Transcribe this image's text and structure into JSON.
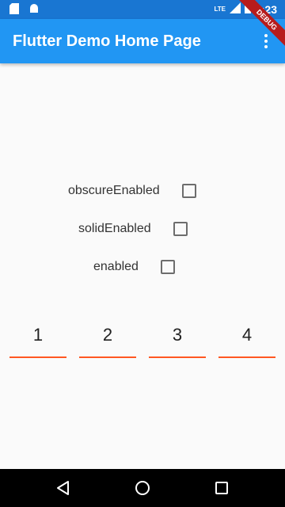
{
  "status_bar": {
    "network_label": "LTE",
    "time": "6:23"
  },
  "app_bar": {
    "title": "Flutter Demo Home Page",
    "debug_banner": "DEBUG"
  },
  "options": [
    {
      "label": "obscureEnabled",
      "checked": false
    },
    {
      "label": "solidEnabled",
      "checked": false
    },
    {
      "label": "enabled",
      "checked": false
    }
  ],
  "code_fields": [
    {
      "value": "1"
    },
    {
      "value": "2"
    },
    {
      "value": "3"
    },
    {
      "value": "4"
    }
  ],
  "colors": {
    "app_bar": "#2196f3",
    "status_bar": "#1976d2",
    "underline": "#ff5722"
  }
}
